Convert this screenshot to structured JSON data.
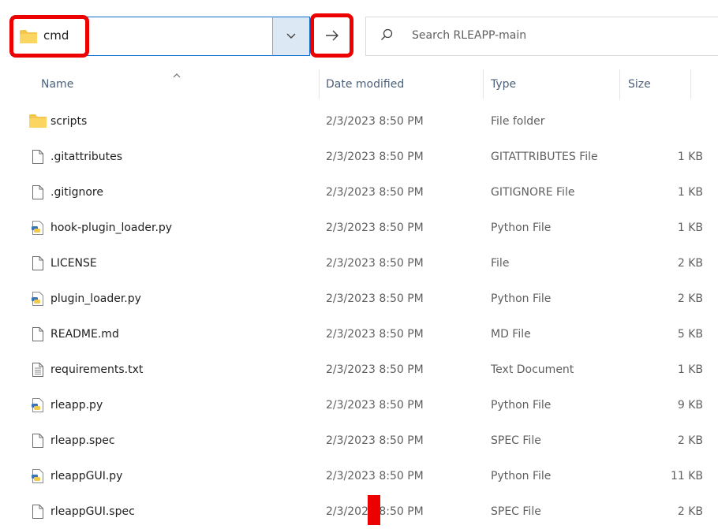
{
  "address_bar": {
    "path_label": "cmd"
  },
  "search": {
    "placeholder": "Search RLEAPP-main"
  },
  "columns": {
    "name": "Name",
    "date": "Date modified",
    "type": "Type",
    "size": "Size"
  },
  "files": [
    {
      "icon": "folder-icon",
      "name": "scripts",
      "date": "2/3/2023 8:50 PM",
      "type": "File folder",
      "size": ""
    },
    {
      "icon": "file-icon",
      "name": ".gitattributes",
      "date": "2/3/2023 8:50 PM",
      "type": "GITATTRIBUTES File",
      "size": "1 KB"
    },
    {
      "icon": "file-icon",
      "name": ".gitignore",
      "date": "2/3/2023 8:50 PM",
      "type": "GITIGNORE File",
      "size": "1 KB"
    },
    {
      "icon": "python-file-icon",
      "name": "hook-plugin_loader.py",
      "date": "2/3/2023 8:50 PM",
      "type": "Python File",
      "size": "1 KB"
    },
    {
      "icon": "file-icon",
      "name": "LICENSE",
      "date": "2/3/2023 8:50 PM",
      "type": "File",
      "size": "2 KB"
    },
    {
      "icon": "python-file-icon",
      "name": "plugin_loader.py",
      "date": "2/3/2023 8:50 PM",
      "type": "Python File",
      "size": "2 KB"
    },
    {
      "icon": "file-icon",
      "name": "README.md",
      "date": "2/3/2023 8:50 PM",
      "type": "MD File",
      "size": "5 KB"
    },
    {
      "icon": "text-file-icon",
      "name": "requirements.txt",
      "date": "2/3/2023 8:50 PM",
      "type": "Text Document",
      "size": "1 KB"
    },
    {
      "icon": "python-file-icon",
      "name": "rleapp.py",
      "date": "2/3/2023 8:50 PM",
      "type": "Python File",
      "size": "9 KB"
    },
    {
      "icon": "file-icon",
      "name": "rleapp.spec",
      "date": "2/3/2023 8:50 PM",
      "type": "SPEC File",
      "size": "2 KB"
    },
    {
      "icon": "python-file-icon",
      "name": "rleappGUI.py",
      "date": "2/3/2023 8:50 PM",
      "type": "Python File",
      "size": "11 KB"
    },
    {
      "icon": "file-icon",
      "name": "rleappGUI.spec",
      "date": "2/3/2023 8:50 PM",
      "type": "SPEC File",
      "size": "2 KB"
    }
  ],
  "colors": {
    "highlight": "#ec0000",
    "accent": "#0e6fd0",
    "folder": "#f4c64e"
  }
}
